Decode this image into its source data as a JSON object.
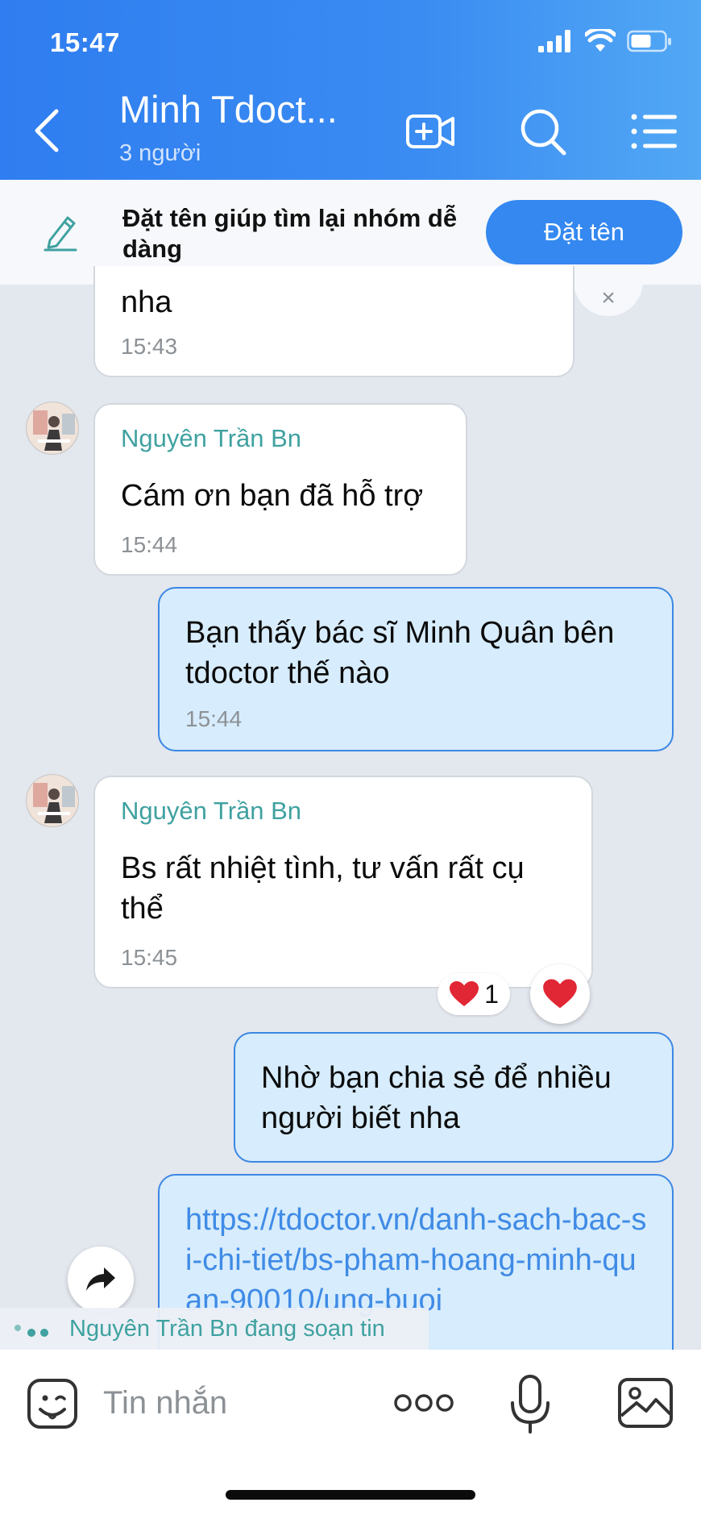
{
  "status_bar": {
    "time": "15:47"
  },
  "header": {
    "title": "Minh Tdoct...",
    "subtitle": "3 người"
  },
  "banner": {
    "text": "Đặt tên giúp tìm lại nhóm dễ dàng",
    "button_label": "Đặt tên",
    "close_label": "×"
  },
  "messages": [
    {
      "direction": "in",
      "sender": "",
      "text": "nha",
      "time": "15:43"
    },
    {
      "direction": "in",
      "sender": "Nguyên Trần Bn",
      "text": "Cám ơn bạn đã hỗ trợ",
      "time": "15:44"
    },
    {
      "direction": "out",
      "sender": "",
      "text": "Bạn thấy bác sĩ Minh Quân bên tdoctor thế nào",
      "time": "15:44"
    },
    {
      "direction": "in",
      "sender": "Nguyên Trần Bn",
      "text": "Bs rất nhiệt tình, tư vấn rất cụ thể",
      "time": "15:45",
      "reaction_count": "1"
    },
    {
      "direction": "out",
      "sender": "",
      "text": "Nhờ bạn chia sẻ để nhiều người biết nha",
      "time": ""
    },
    {
      "direction": "out",
      "sender": "",
      "text": "https://tdoctor.vn/danh-sach-bac-si-chi-tiet/bs-pham-hoang-minh-quan-90010/ung-buoi",
      "time": ""
    }
  ],
  "typing_indicator": "Nguyên Trần Bn đang soạn tin",
  "input": {
    "placeholder": "Tin nhắn"
  },
  "colors": {
    "header_start": "#2f7df0",
    "header_end": "#52a8f4",
    "sender_name": "#3fa1a0",
    "outgoing_bubble": "#d7ecfc",
    "link": "#3f8be6",
    "accent_button": "#3488f0"
  },
  "icons": [
    "back-icon",
    "video-add-icon",
    "search-icon",
    "menu-icon",
    "pencil-icon",
    "heart-icon",
    "share-icon",
    "sticker-icon",
    "more-icon",
    "mic-icon",
    "image-icon"
  ]
}
